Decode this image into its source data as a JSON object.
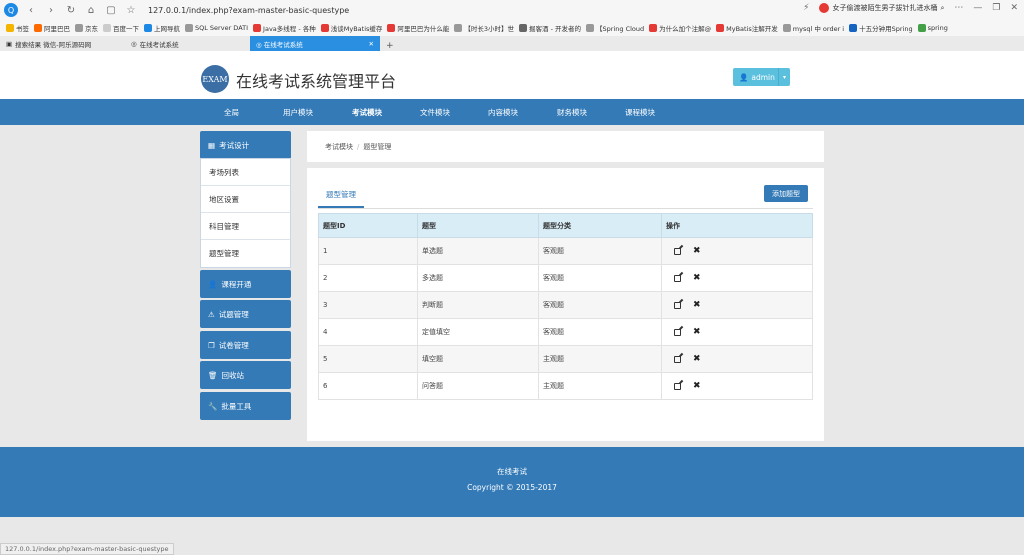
{
  "browser": {
    "url": "127.0.0.1/index.php?exam-master-basic-questype",
    "search_text": "女子偷渡被陌生男子拔针扎进水桶",
    "bookmarks": [
      "书签",
      "阿里巴巴",
      "京东",
      "百度一下",
      "上网导航",
      "SQL Server DATI",
      "Java多线程 - 各种",
      "浅谈MyBatis缓存",
      "阿里巴巴为什么能",
      "【时长3小时】世",
      "掘客酒 - 开发者的",
      "【Spring Cloud",
      "为什么加个注解@",
      "MyBatis注解开发",
      "mysql 中 order i",
      "十五分钟用Spring",
      "spring"
    ],
    "tabs": [
      {
        "label": "搜索结果 微信-阿乐源码网",
        "active": false
      },
      {
        "label": "在线考试系统",
        "active": false
      },
      {
        "label": "在线考试系统",
        "active": true
      }
    ],
    "status_url": "127.0.0.1/index.php?exam-master-basic-questype"
  },
  "header": {
    "logo_text": "EXAM",
    "title": "在线考试系统管理平台",
    "user": "admin"
  },
  "nav": [
    {
      "label": "全局",
      "active": false
    },
    {
      "label": "用户模块",
      "active": false
    },
    {
      "label": "考试模块",
      "active": true
    },
    {
      "label": "文件模块",
      "active": false
    },
    {
      "label": "内容模块",
      "active": false
    },
    {
      "label": "财务模块",
      "active": false
    },
    {
      "label": "课程模块",
      "active": false
    }
  ],
  "sidebar": {
    "groups": [
      {
        "label": "考试设计",
        "icon": "grid-icon"
      },
      {
        "label": "课程开通",
        "icon": "user-icon"
      },
      {
        "label": "试题管理",
        "icon": "warning-icon"
      },
      {
        "label": "试卷管理",
        "icon": "copy-icon"
      },
      {
        "label": "回收站",
        "icon": "trash-icon"
      },
      {
        "label": "批量工具",
        "icon": "wrench-icon"
      }
    ],
    "sub_items": [
      "考场列表",
      "地区设置",
      "科目管理",
      "题型管理"
    ]
  },
  "breadcrumb": [
    "考试模块",
    "题型管理"
  ],
  "panel": {
    "tab_label": "题型管理",
    "add_button": "添加题型"
  },
  "table": {
    "headers": [
      "题型ID",
      "题型",
      "题型分类",
      "操作"
    ],
    "rows": [
      {
        "id": "1",
        "name": "单选题",
        "category": "客观题"
      },
      {
        "id": "2",
        "name": "多选题",
        "category": "客观题"
      },
      {
        "id": "3",
        "name": "判断题",
        "category": "客观题"
      },
      {
        "id": "4",
        "name": "定值填空",
        "category": "客观题"
      },
      {
        "id": "5",
        "name": "填空题",
        "category": "主观题"
      },
      {
        "id": "6",
        "name": "问答题",
        "category": "主观题"
      }
    ]
  },
  "footer": {
    "line1": "在线考试",
    "line2": "Copyright © 2015-2017"
  }
}
